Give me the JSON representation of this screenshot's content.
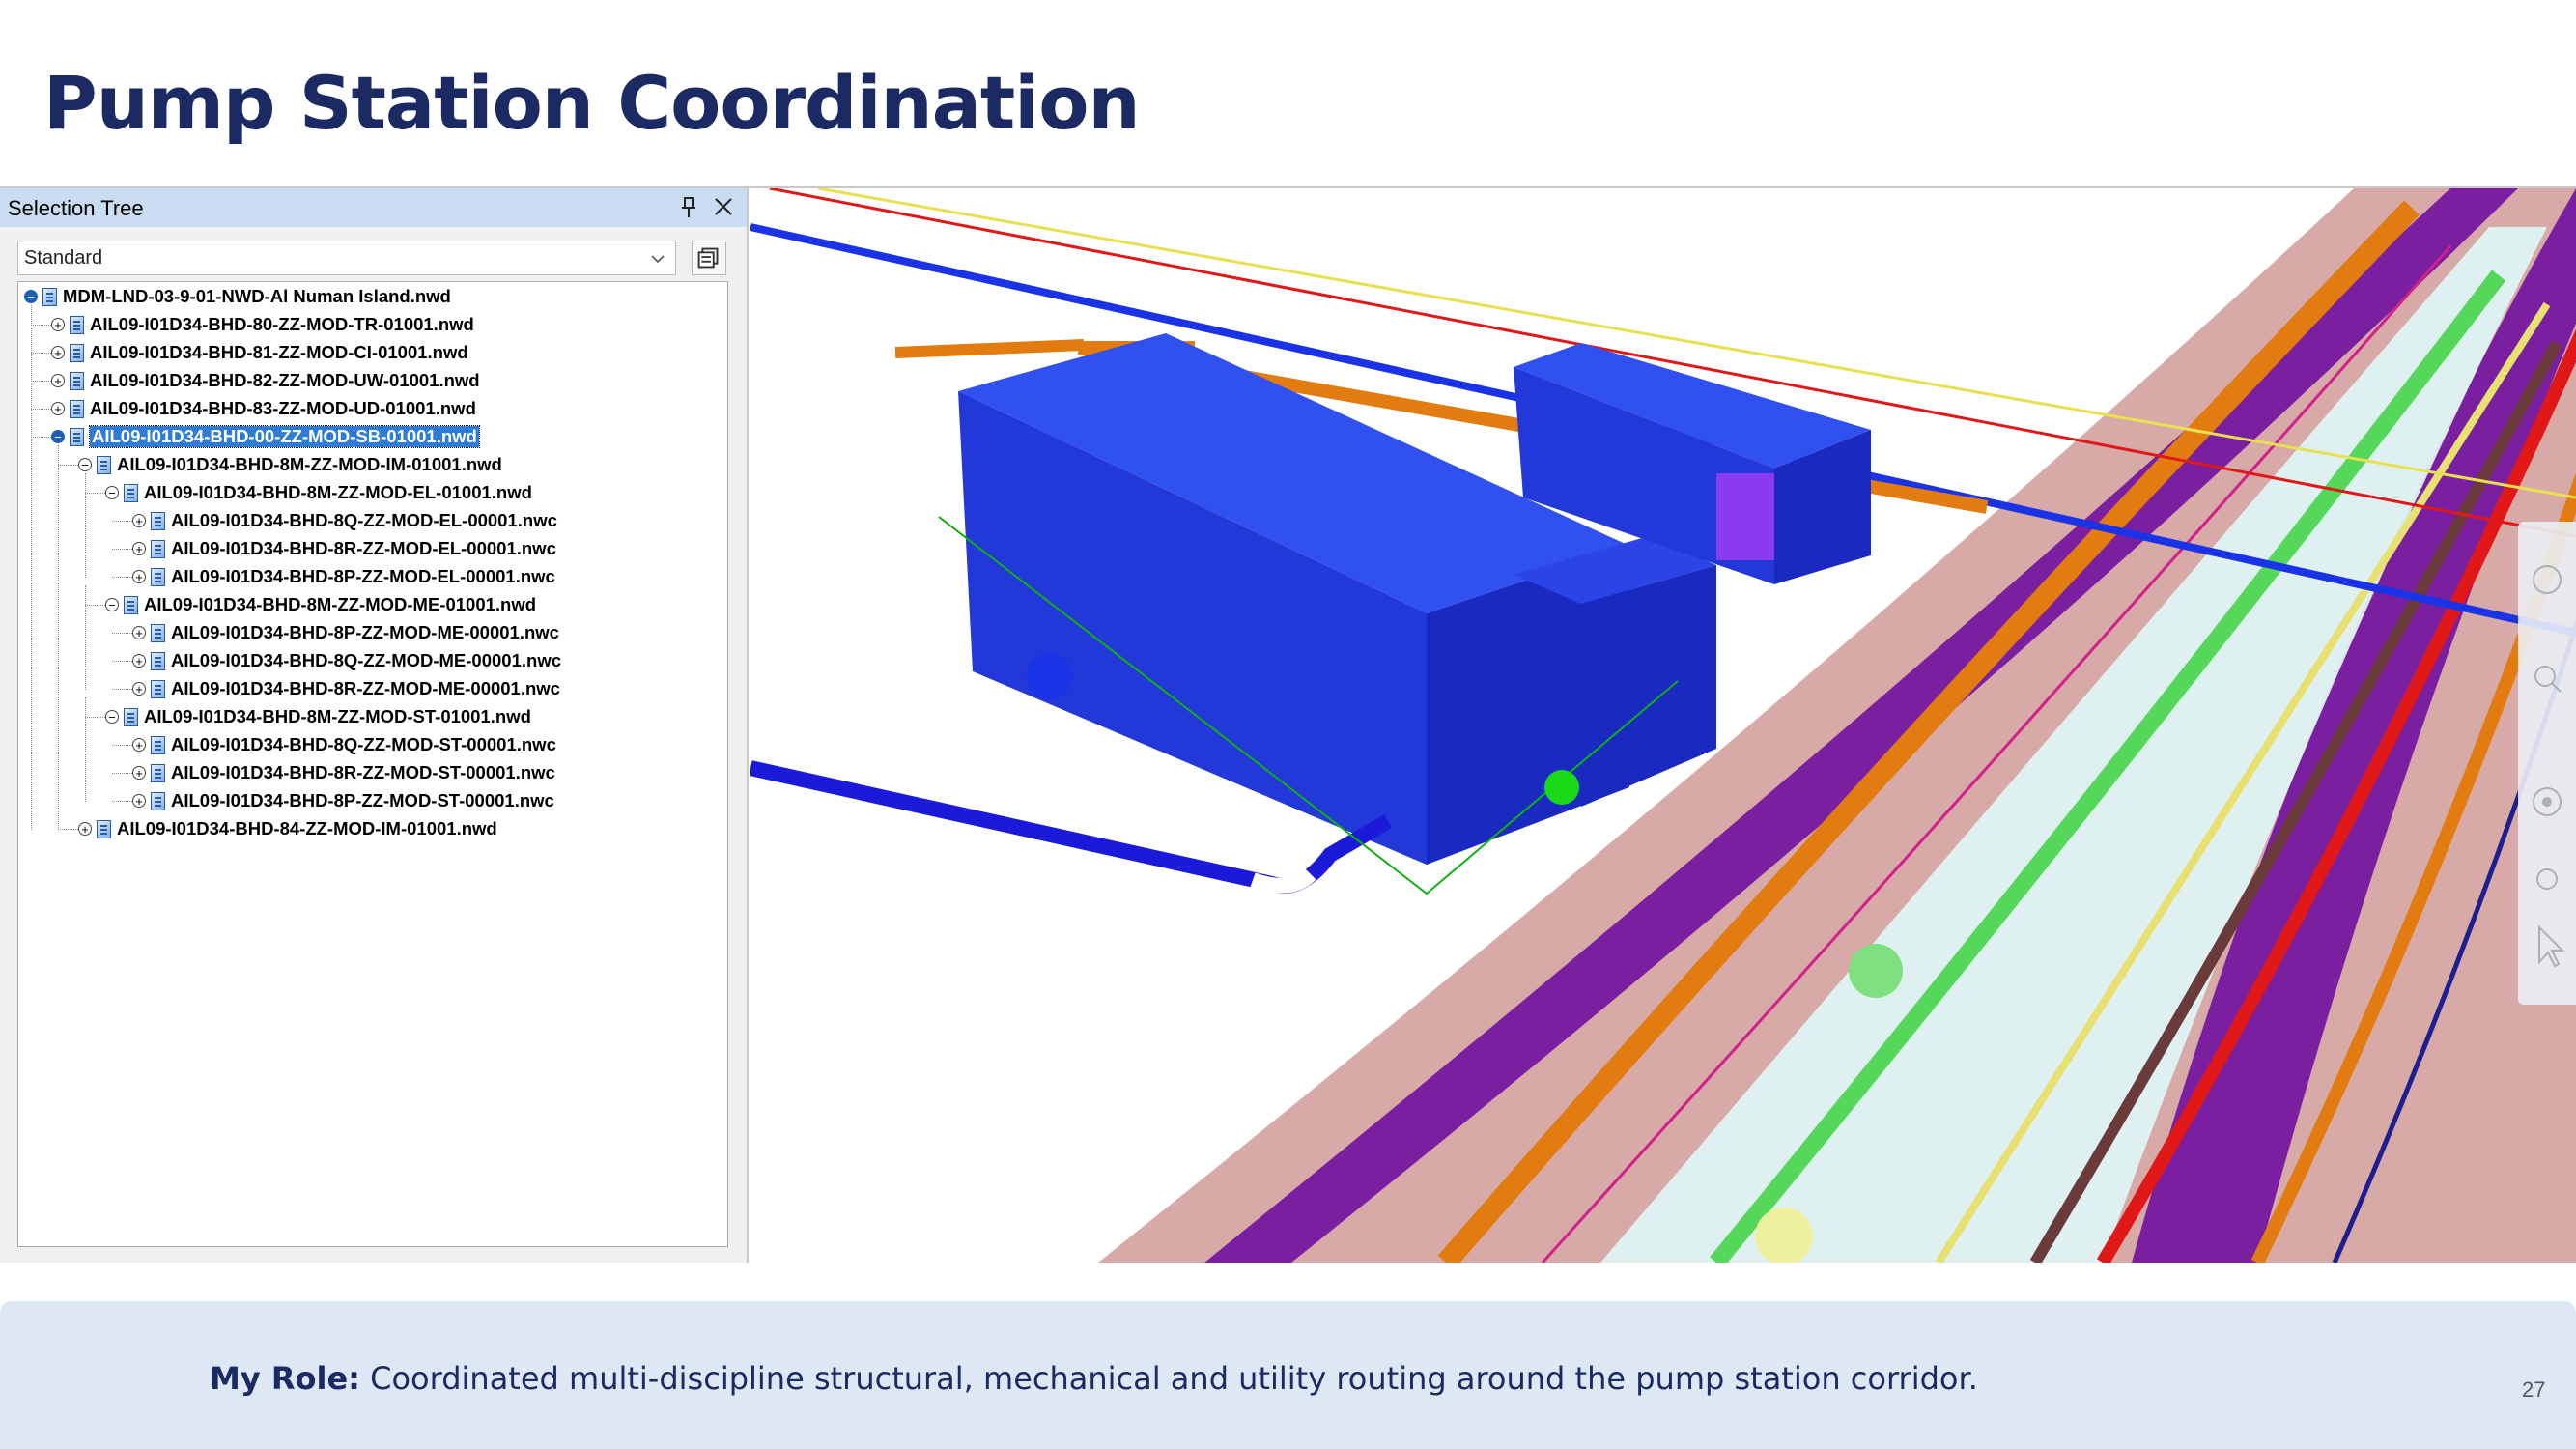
{
  "slide": {
    "title": "Pump Station Coordination",
    "role_label": "My Role:",
    "role_text": "Coordinated multi-discipline structural, mechanical and utility routing around the pump station corridor.",
    "page_number": "27"
  },
  "panel": {
    "title": "Selection Tree",
    "dropdown_value": "Standard",
    "tree": [
      {
        "label": "MDM-LND-03-9-01-NWD-Al Numan Island.nwd",
        "expander": "minus-blue"
      },
      {
        "label": "AIL09-I01D34-BHD-80-ZZ-MOD-TR-01001.nwd",
        "expander": "plus"
      },
      {
        "label": "AIL09-I01D34-BHD-81-ZZ-MOD-CI-01001.nwd",
        "expander": "plus"
      },
      {
        "label": "AIL09-I01D34-BHD-82-ZZ-MOD-UW-01001.nwd",
        "expander": "plus"
      },
      {
        "label": "AIL09-I01D34-BHD-83-ZZ-MOD-UD-01001.nwd",
        "expander": "plus"
      },
      {
        "label": "AIL09-I01D34-BHD-00-ZZ-MOD-SB-01001.nwd",
        "expander": "minus-blue",
        "selected": true
      },
      {
        "label": "AIL09-I01D34-BHD-8M-ZZ-MOD-IM-01001.nwd",
        "expander": "minus"
      },
      {
        "label": "AIL09-I01D34-BHD-8M-ZZ-MOD-EL-01001.nwd",
        "expander": "minus"
      },
      {
        "label": "AIL09-I01D34-BHD-8Q-ZZ-MOD-EL-00001.nwc",
        "expander": "plus"
      },
      {
        "label": "AIL09-I01D34-BHD-8R-ZZ-MOD-EL-00001.nwc",
        "expander": "plus"
      },
      {
        "label": "AIL09-I01D34-BHD-8P-ZZ-MOD-EL-00001.nwc",
        "expander": "plus"
      },
      {
        "label": "AIL09-I01D34-BHD-8M-ZZ-MOD-ME-01001.nwd",
        "expander": "minus"
      },
      {
        "label": "AIL09-I01D34-BHD-8P-ZZ-MOD-ME-00001.nwc",
        "expander": "plus"
      },
      {
        "label": "AIL09-I01D34-BHD-8Q-ZZ-MOD-ME-00001.nwc",
        "expander": "plus"
      },
      {
        "label": "AIL09-I01D34-BHD-8R-ZZ-MOD-ME-00001.nwc",
        "expander": "plus"
      },
      {
        "label": "AIL09-I01D34-BHD-8M-ZZ-MOD-ST-01001.nwd",
        "expander": "minus"
      },
      {
        "label": "AIL09-I01D34-BHD-8Q-ZZ-MOD-ST-00001.nwc",
        "expander": "plus"
      },
      {
        "label": "AIL09-I01D34-BHD-8R-ZZ-MOD-ST-00001.nwc",
        "expander": "plus"
      },
      {
        "label": "AIL09-I01D34-BHD-8P-ZZ-MOD-ST-00001.nwc",
        "expander": "plus"
      },
      {
        "label": "AIL09-I01D34-BHD-84-ZZ-MOD-IM-01001.nwd",
        "expander": "plus"
      }
    ]
  },
  "icons": {
    "pin": "pin-icon",
    "close": "close-icon",
    "dropdown": "chevron-down-icon",
    "sets": "selection-sets-icon",
    "nav_wheel": "steering-wheel-icon",
    "pan": "pan-hand-icon",
    "zoom": "zoom-icon",
    "orbit": "orbit-icon",
    "look": "look-icon",
    "select": "select-cursor-icon"
  },
  "colors": {
    "title": "#1b2a63",
    "panel_header": "#c9dcf2",
    "selection": "#2e7cd6",
    "footer": "#dde8f4",
    "structure": "#1a33e6",
    "duct": "#e27c10",
    "corridor_purple": "#7a1fa0",
    "corridor_pink": "#d8a8a6",
    "pipe_green": "#55d85a",
    "pipe_red": "#e01818"
  }
}
